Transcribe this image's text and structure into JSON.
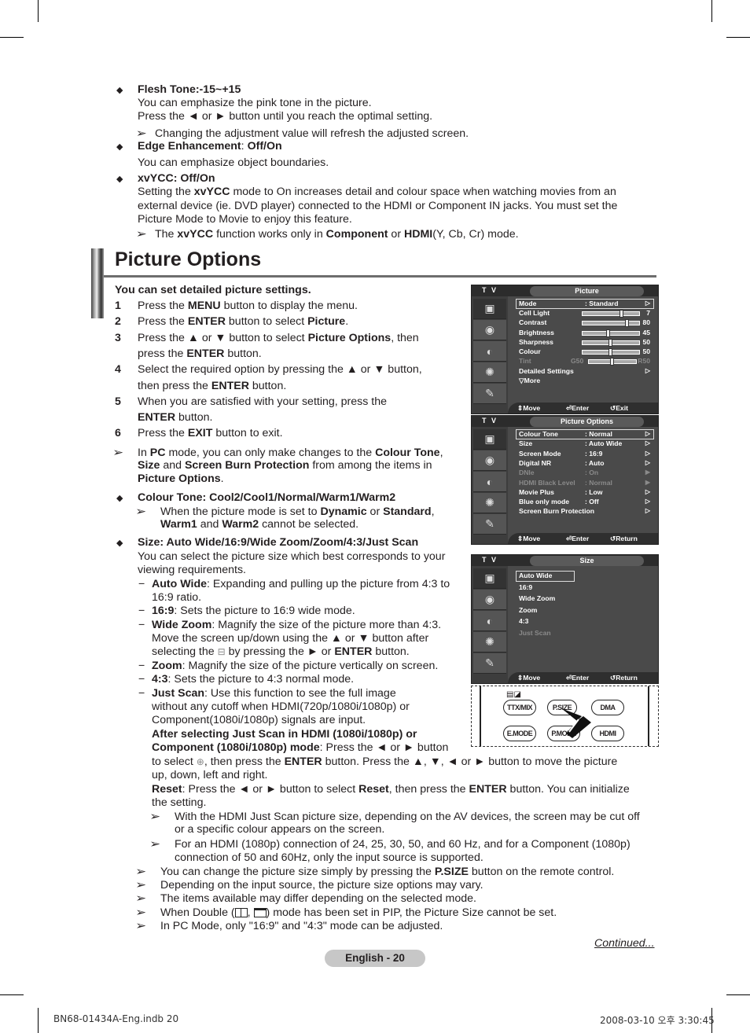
{
  "top_bullets": [
    {
      "heading": "Flesh Tone:-15~+15",
      "lines": [
        "You can emphasize the pink tone in the picture.",
        "Press the ◄ or ► button until you reach the optimal setting."
      ],
      "note": "Changing the adjustment value will refresh the adjusted screen."
    },
    {
      "heading_bold": "Edge Enhancement",
      "heading_sep": ": ",
      "heading_value": "Off/On",
      "lines": [
        "You can emphasize object boundaries."
      ]
    },
    {
      "heading": "xvYCC: Off/On",
      "line1": {
        "pre": "Setting the ",
        "bold": "xvYCC",
        "post": " mode to On increases detail and colour space when watching movies from an"
      },
      "line2": "external device (ie. DVD player) connected to the HDMI or Component IN jacks. You must set the",
      "line3": "Picture Mode to Movie to enjoy this feature.",
      "note": {
        "pre": "The ",
        "b1": "xvYCC",
        "mid": " function works only in ",
        "b2": "Component",
        "or": " or ",
        "b3": "HDMI",
        "post": "(Y, Cb, Cr) mode."
      }
    }
  ],
  "section_title": "Picture Options",
  "intro": "You can set detailed picture settings.",
  "steps": [
    {
      "n": "1",
      "pre": "Press the ",
      "b": "MENU",
      "post": " button to display the menu."
    },
    {
      "n": "2",
      "pre": "Press the ",
      "b": "ENTER",
      "mid": " button to select ",
      "b2": "Picture",
      "post": "."
    },
    {
      "n": "3",
      "pre": "Press the ▲ or ▼ button to select ",
      "b": "Picture Options",
      "post": ", then",
      "cont_pre": "press the ",
      "cont_b": "ENTER",
      "cont_post": " button."
    },
    {
      "n": "4",
      "pre": "Select the required option by pressing the ▲ or ▼ button,",
      "cont_pre": "then press the ",
      "cont_b": "ENTER",
      "cont_post": " button."
    },
    {
      "n": "5",
      "pre": "When you are satisfied with your setting, press the",
      "cont_b": "ENTER",
      "cont_post": " button."
    },
    {
      "n": "6",
      "pre": "Press the ",
      "b": "EXIT",
      "post": " button to exit."
    }
  ],
  "pc_note": {
    "l1_pre": "In ",
    "l1_b": "PC",
    "l1_mid": " mode, you can only make changes to the ",
    "l1_b2": "Colour Tone",
    "l1_post": ",",
    "l2_b": "Size",
    "l2_mid": " and ",
    "l2_b2": "Screen Burn Protection",
    "l2_post": " from among the items in",
    "l3_b": "Picture Options",
    "l3_post": "."
  },
  "colour_tone": {
    "heading": "Colour Tone: Cool2/Cool1/Normal/Warm1/Warm2",
    "note_pre": "When the picture mode is set to ",
    "b1": "Dynamic",
    "or": " or ",
    "b2": "Standard",
    "comma": ",",
    "l2_b1": "Warm1",
    "l2_and": " and ",
    "l2_b2": "Warm2",
    "l2_post": " cannot be selected."
  },
  "size": {
    "heading": "Size: Auto Wide/16:9/Wide Zoom/Zoom/4:3/Just Scan",
    "desc1": "You can select the picture size which best corresponds to your",
    "desc2": "viewing requirements.",
    "items": [
      {
        "b": "Auto Wide",
        "text": ": Expanding and pulling up the picture from 4:3 to",
        "cont": "16:9 ratio."
      },
      {
        "b": "16:9",
        "text": ": Sets the picture to 16:9 wide mode."
      },
      {
        "b": "Wide Zoom",
        "text": ": Magnify the size of the picture more than 4:3.",
        "cont": "Move the screen up/down using the ▲ or ▼ button after",
        "cont2_pre": "selecting the ",
        "cont2_mid": " by pressing the ► or ",
        "cont2_b": "ENTER",
        "cont2_post": " button."
      },
      {
        "b": "Zoom",
        "text": ": Magnify the size of the picture vertically on screen."
      },
      {
        "b": "4:3",
        "text": ": Sets the picture to 4:3 normal mode."
      },
      {
        "b": "Just Scan",
        "text": ": Use this function to see the full image"
      }
    ],
    "just_scan": {
      "l2": "without any cutoff when HDMI(720p/1080i/1080p) or",
      "l3": "Component(1080i/1080p) signals are input.",
      "l4_b": "After selecting Just Scan in HDMI (1080i/1080p) or",
      "l5_b": "Component (1080i/1080p) mode",
      "l5_post": ": Press the ◄ or ► button",
      "l6_pre": "to select ",
      "l6_mid": ", then press the ",
      "l6_b": "ENTER",
      "l6_post": " button. Press the ▲, ▼, ◄ or ► button to move the picture",
      "l7": "up, down, left and right.",
      "l8_b": "Reset",
      "l8_mid": ": Press the ◄ or ► button to select ",
      "l8_b2": "Reset",
      "l8_mid2": ", then press the ",
      "l8_b3": "ENTER",
      "l8_post": " button. You can initialize",
      "l9": "the setting.",
      "notes": [
        {
          "l1": "With the HDMI Just Scan picture size, depending on the AV devices, the screen may be cut off",
          "l2": "or a specific colour appears on the screen."
        },
        {
          "l1": "For an HDMI (1080p) connection of 24, 25, 30, 50, and 60 Hz, and for a Component (1080p)",
          "l2": "connection of 50 and 60Hz, only the input source is supported."
        }
      ]
    }
  },
  "bottom_notes": [
    {
      "pre": "You can change the picture size simply by pressing the ",
      "b": "P.SIZE",
      "post": " button on the remote control."
    },
    {
      "pre": "Depending on the input source, the picture size options may vary."
    },
    {
      "pre": "The items available may differ depending on the selected mode."
    },
    {
      "pre": "When Double (",
      "mid": ", ",
      "post": ") mode has been set in PIP, the Picture Size cannot be set."
    },
    {
      "pre": "In PC Mode, only \"16:9\" and \"4:3\" mode can be adjusted."
    }
  ],
  "continued": "Continued...",
  "page_label": "English - 20",
  "footer_left": "BN68-01434A-Eng.indb   20",
  "footer_right": "2008-03-10   오후 3:30:45",
  "osd_common": {
    "tv_label": "T V",
    "move": "Move",
    "enter": "Enter"
  },
  "osd_picture": {
    "title": "Picture",
    "exit": "Exit",
    "mode": {
      "label": "Mode",
      "value": ": Standard"
    },
    "sliders": [
      {
        "label": "Cell Light",
        "value": 7,
        "max": 10
      },
      {
        "label": "Contrast",
        "value": 80,
        "max": 100
      },
      {
        "label": "Brightness",
        "value": 45,
        "max": 100
      },
      {
        "label": "Sharpness",
        "value": 50,
        "max": 100
      },
      {
        "label": "Colour",
        "value": 50,
        "max": 100
      }
    ],
    "tint": {
      "label": "Tint",
      "left": "G50",
      "right": "R50",
      "value": 0.5
    },
    "detailed": "Detailed Settings",
    "more": "▽More"
  },
  "osd_options": {
    "title": "Picture Options",
    "return": "Return",
    "rows": [
      {
        "label": "Colour Tone",
        "value": ": Normal",
        "dim": false,
        "chev": "▷"
      },
      {
        "label": "Size",
        "value": ": Auto Wide",
        "dim": false,
        "chev": "▷"
      },
      {
        "label": "Screen Mode",
        "value": ": 16:9",
        "dim": false,
        "chev": "▷"
      },
      {
        "label": "Digital NR",
        "value": ": Auto",
        "dim": false,
        "chev": "▷"
      },
      {
        "label": "DNIe",
        "value": ": On",
        "dim": true,
        "chev": "▶"
      },
      {
        "label": "HDMI Black Level",
        "value": ": Normal",
        "dim": true,
        "chev": "▶"
      },
      {
        "label": "Movie Plus",
        "value": ": Low",
        "dim": false,
        "chev": "▷"
      },
      {
        "label": "Blue only mode",
        "value": ": Off",
        "dim": false,
        "chev": "▷"
      },
      {
        "label": "Screen Burn Protection",
        "value": "",
        "dim": false,
        "chev": "▷"
      }
    ]
  },
  "osd_size": {
    "title": "Size",
    "return": "Return",
    "rows": [
      {
        "label": "Auto Wide",
        "dim": false
      },
      {
        "label": "16:9",
        "dim": false
      },
      {
        "label": "Wide Zoom",
        "dim": false
      },
      {
        "label": "Zoom",
        "dim": false
      },
      {
        "label": "4:3",
        "dim": false
      },
      {
        "label": "Just Scan",
        "dim": true
      }
    ]
  },
  "remote": {
    "buttons": [
      "TTX/MIX",
      "P.SIZE",
      "DMA",
      "E.MODE",
      "P.MODE",
      "HDMI"
    ]
  },
  "colors": {
    "osd_bg": "#4a4a4a",
    "osd_dim": "#8a8a8a",
    "title_rule": "#6d6d6d",
    "page_badge": "#c7c7c7"
  }
}
